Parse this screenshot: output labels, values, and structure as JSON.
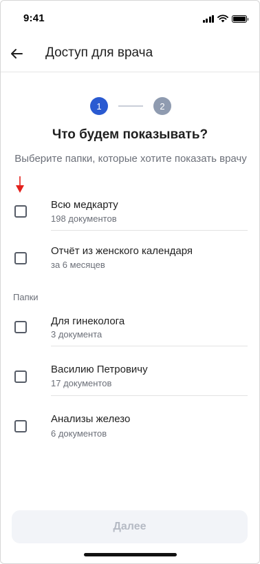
{
  "status_bar": {
    "time": "9:41",
    "icons": [
      "signal-icon",
      "wifi-icon",
      "battery-icon"
    ]
  },
  "header": {
    "back_icon": "arrow-left-icon",
    "title": "Доступ для врача"
  },
  "stepper": {
    "step1": "1",
    "step2": "2",
    "active_color": "#2a5ad1",
    "inactive_color": "#8f9bb0"
  },
  "main": {
    "title": "Что будем показывать?",
    "subtitle": "Выберите папки, которые хотите показать врачу"
  },
  "options": [
    {
      "title": "Всю медкарту",
      "subtitle": "198 документов",
      "checked": false
    },
    {
      "title": "Отчёт из женского календаря",
      "subtitle": "за 6 месяцев",
      "checked": false
    }
  ],
  "folders_section": {
    "label": "Папки",
    "items": [
      {
        "title": "Для гинеколога",
        "subtitle": "3 документа",
        "checked": false
      },
      {
        "title": "Василию Петровичу",
        "subtitle": "17 документов",
        "checked": false
      },
      {
        "title": "Анализы железо",
        "subtitle": "6 документов",
        "checked": false
      }
    ]
  },
  "footer": {
    "next_label": "Далее",
    "next_enabled": false
  },
  "annotation": {
    "arrow_color": "#e3211c"
  }
}
